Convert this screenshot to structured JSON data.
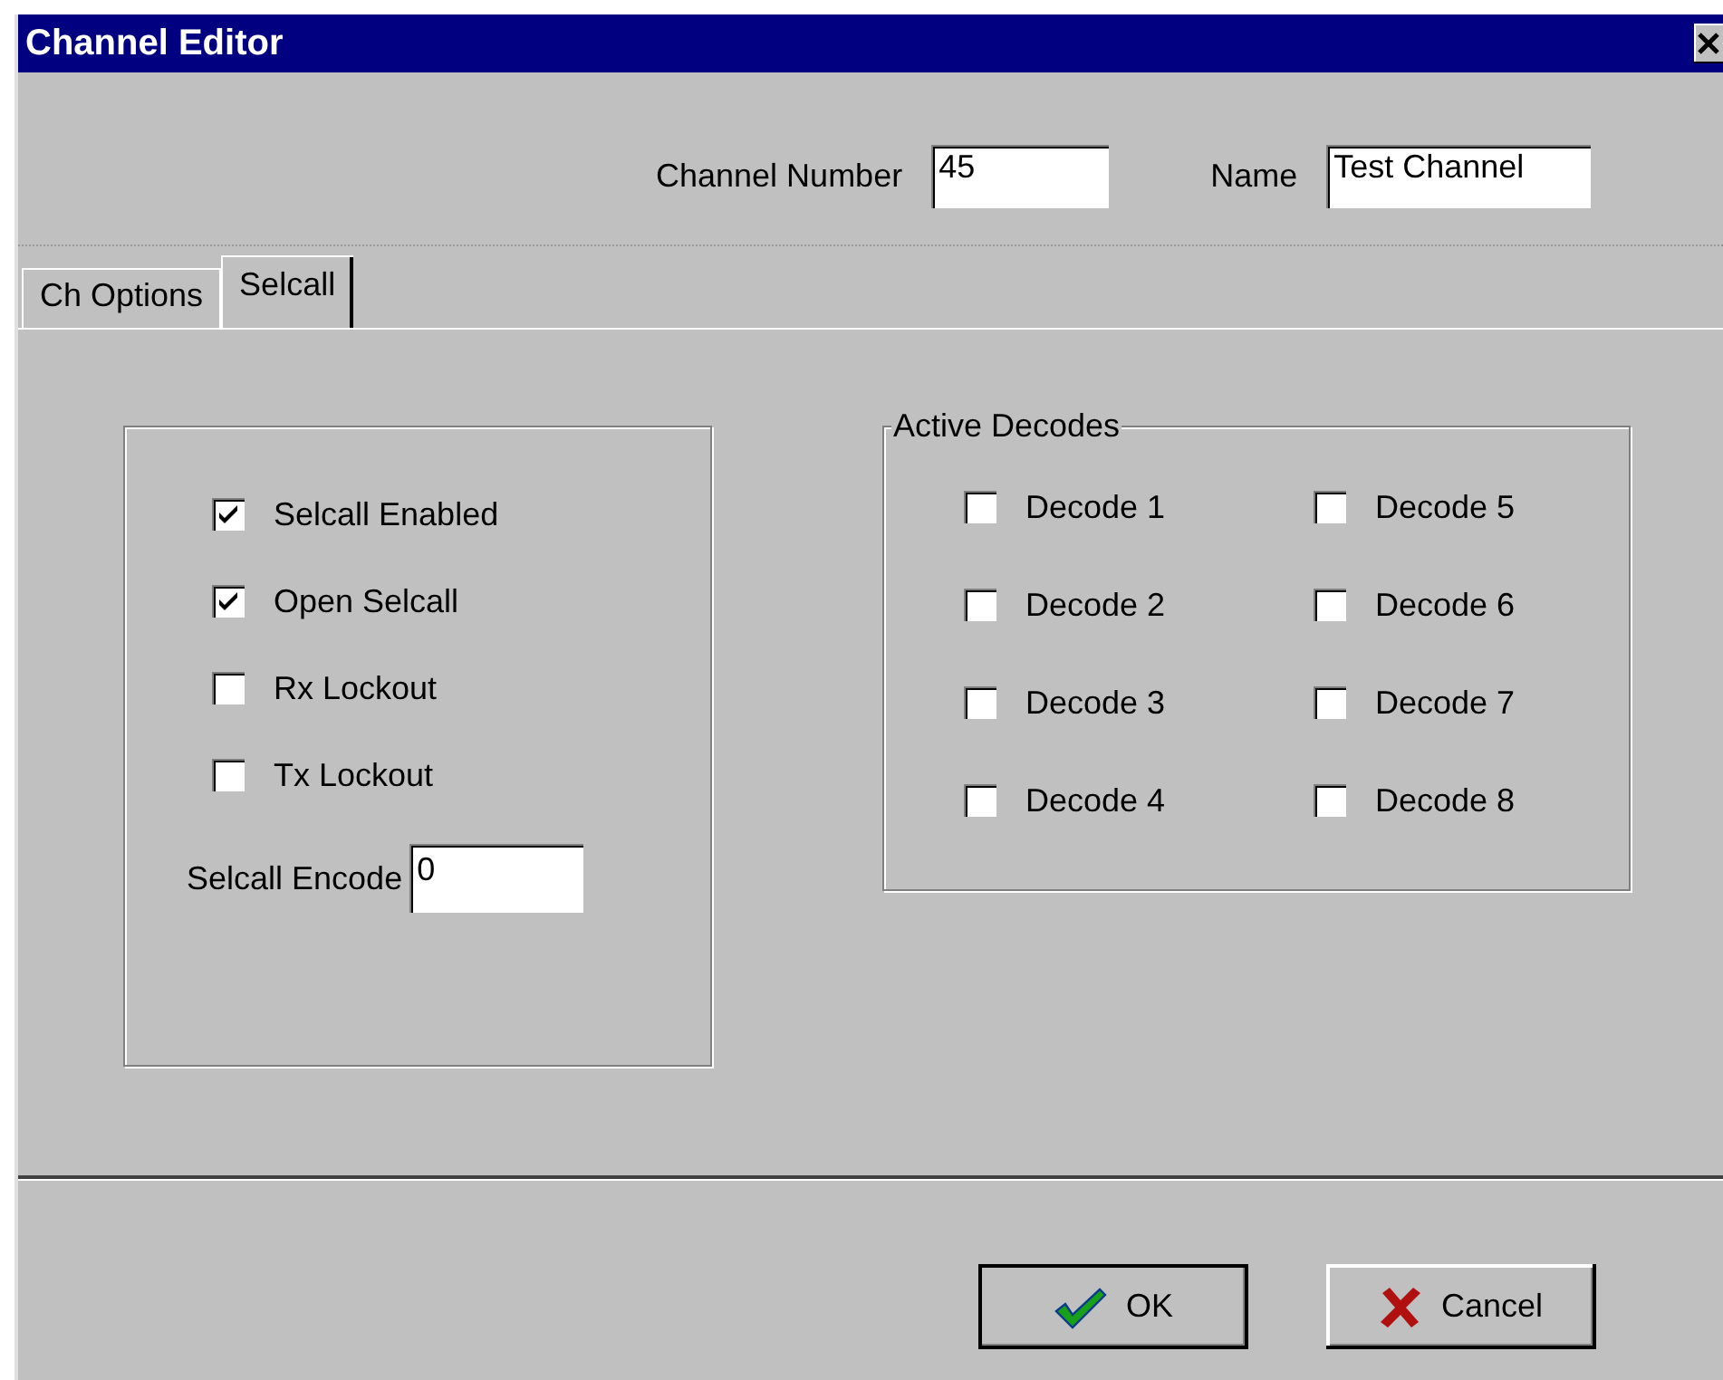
{
  "window": {
    "title": "Channel Editor"
  },
  "header": {
    "channel_number": {
      "label": "Channel Number",
      "value": "45"
    },
    "name": {
      "label": "Name",
      "value": "Test Channel"
    }
  },
  "tabs": [
    {
      "label": "Ch Options",
      "selected": false
    },
    {
      "label": "Selcall",
      "selected": true
    }
  ],
  "options": [
    {
      "label": "Selcall Enabled",
      "checked": true
    },
    {
      "label": "Open Selcall",
      "checked": true
    },
    {
      "label": "Rx Lockout",
      "checked": false
    },
    {
      "label": "Tx Lockout",
      "checked": false
    }
  ],
  "selcall_encode": {
    "label": "Selcall Encode",
    "value": "0"
  },
  "active_decodes": {
    "title": "Active Decodes",
    "items": [
      {
        "label": "Decode 1",
        "checked": false
      },
      {
        "label": "Decode 2",
        "checked": false
      },
      {
        "label": "Decode 3",
        "checked": false
      },
      {
        "label": "Decode 4",
        "checked": false
      },
      {
        "label": "Decode 5",
        "checked": false
      },
      {
        "label": "Decode 6",
        "checked": false
      },
      {
        "label": "Decode 7",
        "checked": false
      },
      {
        "label": "Decode 8",
        "checked": false
      }
    ]
  },
  "buttons": [
    {
      "label": "OK",
      "kind": "ok"
    },
    {
      "label": "Cancel",
      "kind": "cancel"
    }
  ]
}
